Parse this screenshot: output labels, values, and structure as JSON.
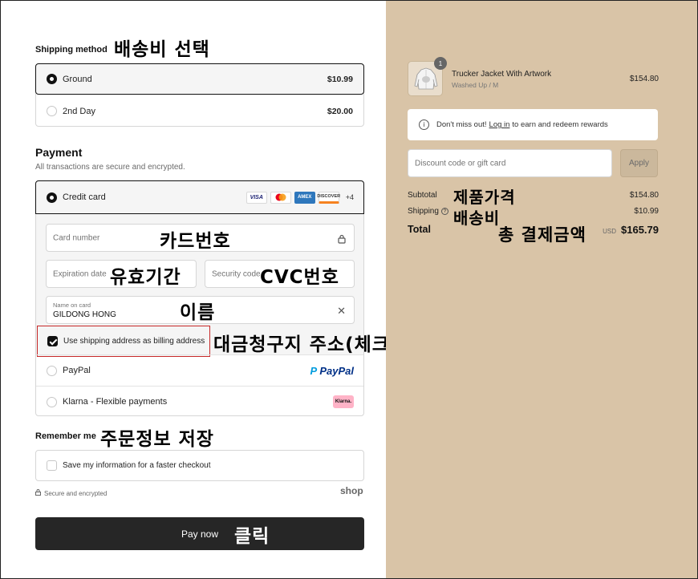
{
  "shipping": {
    "title": "Shipping method",
    "annotation": "배송비 선택",
    "options": [
      {
        "label": "Ground",
        "price": "$10.99",
        "selected": true
      },
      {
        "label": "2nd Day",
        "price": "$20.00",
        "selected": false
      }
    ]
  },
  "payment": {
    "title": "Payment",
    "subtitle": "All transactions are secure and encrypted.",
    "credit_card_label": "Credit card",
    "card_brands": [
      "VISA",
      "mastercard-icon",
      "AMEX",
      "DISCOVER"
    ],
    "more_brands": "+4",
    "card_number_placeholder": "Card number",
    "card_number_annotation": "카드번호",
    "expiration_placeholder": "Expiration date",
    "expiration_annotation": "유효기간",
    "security_placeholder": "Security code",
    "security_annotation": "CVC번호",
    "name_label": "Name on card",
    "name_value": "GILDONG HONG",
    "name_annotation": "이름",
    "billing_label": "Use shipping address as billing address",
    "billing_checked": true,
    "billing_annotation": "대금청구지 주소(체크o)",
    "paypal_label": "PayPal",
    "paypal_logo": "PayPal",
    "klarna_label": "Klarna - Flexible payments",
    "klarna_logo": "Klarna."
  },
  "remember": {
    "title": "Remember me",
    "annotation": "주문정보 저장",
    "save_label": "Save my information for a faster checkout",
    "secure_text": "Secure and encrypted",
    "shop_logo": "shop"
  },
  "pay_button": {
    "label": "Pay now",
    "annotation": "클릭"
  },
  "summary": {
    "item_name": "Trucker Jacket With Artwork",
    "item_variant": "Washed Up / M",
    "item_qty": "1",
    "item_price": "$154.80",
    "notice_pre": "Don't miss out! ",
    "notice_link": "Log in",
    "notice_post": " to earn and redeem rewards",
    "discount_placeholder": "Discount code or gift card",
    "apply_label": "Apply",
    "subtotal_label": "Subtotal",
    "subtotal_annotation": "제품가격",
    "subtotal_value": "$154.80",
    "shipping_label": "Shipping",
    "shipping_annotation": "배송비",
    "shipping_value": "$10.99",
    "total_label": "Total",
    "total_annotation": "총 결제금액",
    "total_currency": "USD",
    "total_value": "$165.79"
  },
  "colors": {
    "right_panel": "#d9c4a7",
    "pay_button": "#262626",
    "highlight_border": "#c62828",
    "paypal_blue": "#003087",
    "paypal_light": "#009cde",
    "klarna_pink": "#ffb3c7"
  }
}
